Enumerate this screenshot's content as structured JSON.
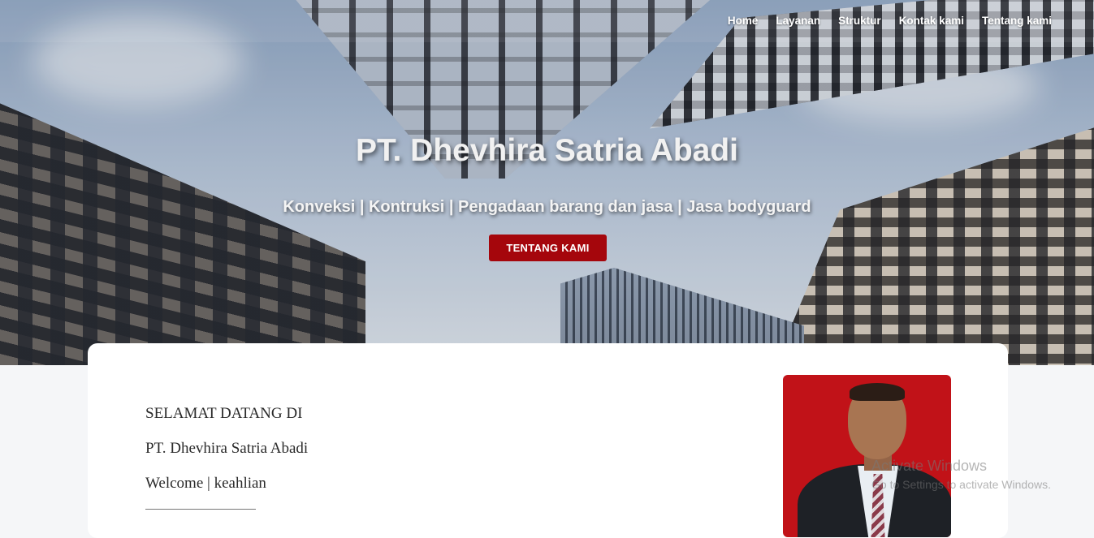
{
  "nav": {
    "items": [
      {
        "label": "Home"
      },
      {
        "label": "Layanan"
      },
      {
        "label": "Struktur"
      },
      {
        "label": "Kontak kami"
      },
      {
        "label": "Tentang kami"
      }
    ]
  },
  "hero": {
    "title": "PT. Dhevhira Satria Abadi",
    "subtitle": "Konveksi | Kontruksi | Pengadaan barang dan jasa | Jasa bodyguard",
    "button_label": "TENTANG KAMI"
  },
  "intro": {
    "line1": "SELAMAT DATANG DI",
    "line2": "PT. Dhevhira Satria Abadi",
    "line3": "Welcome | keahlian"
  },
  "watermark": {
    "title": "Activate Windows",
    "text": "Go to Settings to activate Windows."
  },
  "colors": {
    "accent": "#a5060c",
    "photo_background": "#c11218"
  }
}
